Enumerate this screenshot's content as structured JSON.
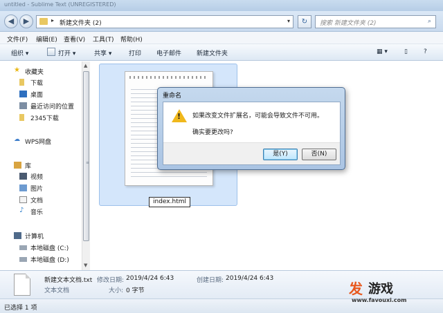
{
  "window": {
    "title": "untitled - Sublime Text (UNREGISTERED)"
  },
  "address_bar": {
    "path": "新建文件夹 (2)",
    "search_placeholder": "搜索 新建文件夹 (2)"
  },
  "menu": [
    "文件(F)",
    "编辑(E)",
    "查看(V)",
    "工具(T)",
    "帮助(H)"
  ],
  "toolbar": {
    "organize": "组织",
    "open": "打开",
    "share": "共享",
    "print": "打印",
    "email": "电子邮件",
    "new_folder": "新建文件夹"
  },
  "nav": {
    "favorites": "收藏夹",
    "downloads": "下载",
    "desktop": "桌面",
    "recent": "最近访问的位置",
    "download_2345": "2345下载",
    "wps": "WPS网盘",
    "libraries": "库",
    "videos": "视频",
    "pictures": "图片",
    "documents": "文档",
    "music": "音乐",
    "computer": "计算机",
    "drive_c": "本地磁盘 (C:)",
    "drive_d": "本地磁盘 (D:)"
  },
  "file": {
    "rename_value": "index.html"
  },
  "dialog": {
    "title": "重命名",
    "message": "如果改变文件扩展名，可能会导致文件不可用。",
    "question": "确实要更改吗?",
    "yes": "是(Y)",
    "no": "否(N)"
  },
  "details": {
    "filename": "新建文本文档.txt",
    "type": "文本文档",
    "modified_label": "修改日期:",
    "modified_value": "2019/4/24 6:43",
    "size_label": "大小:",
    "size_value": "0 字节",
    "created_label": "创建日期:",
    "created_value": "2019/4/24 6:43"
  },
  "status": {
    "selected": "已选择 1 项"
  },
  "watermark": {
    "brand_1": "发",
    "brand_2": "游戏",
    "url": "www.favouxi.com"
  },
  "colors": {
    "accent": "#3c7fb1",
    "warning": "#f0b81c",
    "selection": "#cde2fa"
  }
}
